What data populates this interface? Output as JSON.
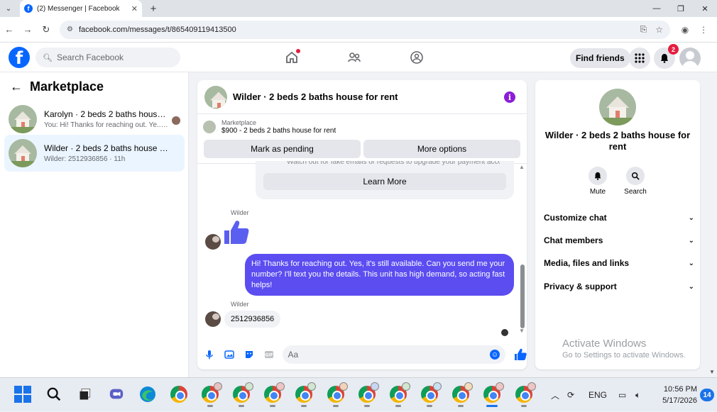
{
  "browser": {
    "tab_title": "(2) Messenger | Facebook",
    "url": "facebook.com/messages/t/865409119413500"
  },
  "header": {
    "search_placeholder": "Search Facebook",
    "find_friends": "Find friends",
    "notifications_count": "2"
  },
  "left": {
    "title": "Marketplace",
    "conversations": [
      {
        "name": "Karolyn · 2 beds 2 baths house f...",
        "preview": "You: Hi! Thanks for reaching out. Ye... · 9h"
      },
      {
        "name": "Wilder · 2 beds 2 baths house for r...",
        "preview": "Wilder: 2512936856 · 11h"
      }
    ]
  },
  "chat": {
    "title": "Wilder · 2 beds 2 baths house for rent",
    "marketplace_label": "Marketplace",
    "listing": "$900 - 2 beds 2 baths house for rent",
    "mark_pending": "Mark as pending",
    "more_options": "More options",
    "warning_text": "Watch out for fake emails or requests to upgrade your payment account.",
    "learn_more": "Learn More",
    "sender_name_1": "Wilder",
    "my_message": "Hi! Thanks for reaching out. Yes, it's still available. Can you send me your number? I'll text you the details. This unit has high demand, so acting fast helps!",
    "sender_name_2": "Wilder",
    "their_message": "2512936856",
    "composer_placeholder": "Aa"
  },
  "right": {
    "title": "Wilder · 2 beds 2 baths house for rent",
    "mute": "Mute",
    "search": "Search",
    "rows": [
      "Customize chat",
      "Chat members",
      "Media, files and links",
      "Privacy & support"
    ],
    "activate_title": "Activate Windows",
    "activate_sub": "Go to Settings to activate Windows."
  },
  "taskbar": {
    "lang": "ENG",
    "time": "10:56 PM",
    "date": "5/17/2026",
    "notif_count": "14"
  }
}
